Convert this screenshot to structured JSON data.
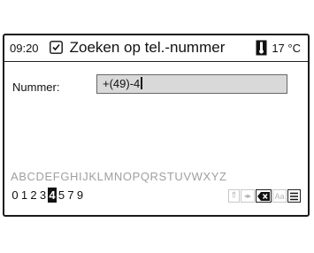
{
  "status": {
    "time": "09:20",
    "title": "Zoeken op tel.-nummer",
    "temperature": "17 °C"
  },
  "form": {
    "label": "Nummer:",
    "value": "+(49)-4"
  },
  "keyboard": {
    "letters": "ABCDEFGHIJKLMNOPQRSTUVWXYZ",
    "digits": [
      "0",
      "1",
      "2",
      "3",
      "4",
      "5",
      "7",
      "9"
    ],
    "selected_digit": "4",
    "keys": {
      "shift": "⇑",
      "cursor": "◂▸",
      "case": "Aa"
    }
  }
}
